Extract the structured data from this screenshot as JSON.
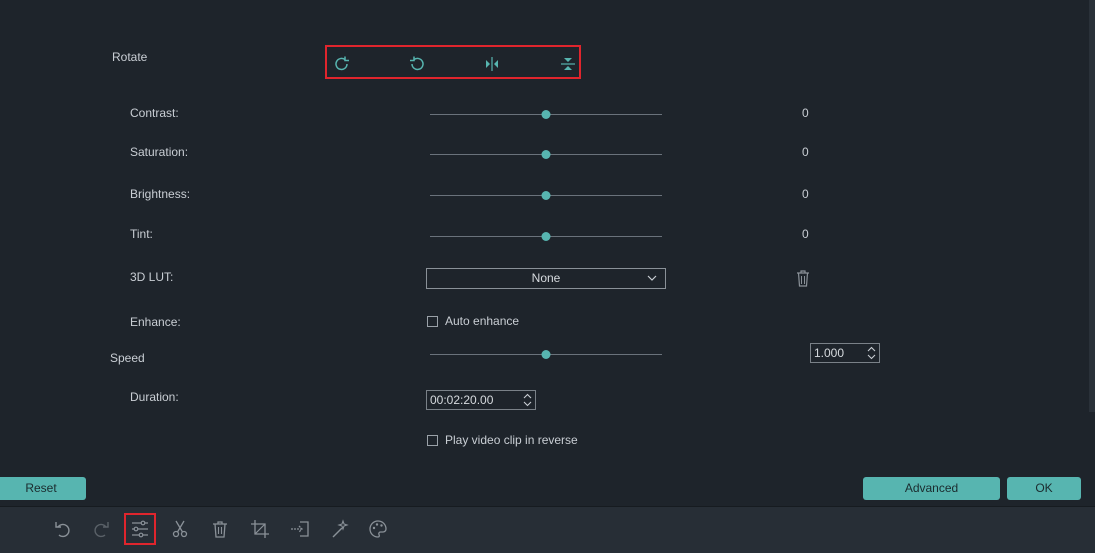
{
  "rotate": {
    "label": "Rotate",
    "icons": [
      "rotate-clockwise-icon",
      "rotate-counterclockwise-icon",
      "flip-horizontal-icon",
      "flip-vertical-icon"
    ]
  },
  "adjust": {
    "contrast": {
      "label": "Contrast:",
      "value": "0",
      "level": 0.5
    },
    "saturation": {
      "label": "Saturation:",
      "value": "0",
      "level": 0.5
    },
    "brightness": {
      "label": "Brightness:",
      "value": "0",
      "level": 0.5
    },
    "tint": {
      "label": "Tint:",
      "value": "0",
      "level": 0.5
    }
  },
  "lut": {
    "label": "3D LUT:",
    "selected": "None"
  },
  "enhance": {
    "label": "Enhance:",
    "checkbox_label": "Auto enhance",
    "checked": false
  },
  "speed": {
    "label": "Speed",
    "value": "1.000",
    "level": 0.5
  },
  "duration": {
    "label": "Duration:",
    "value": "00:02:20.00"
  },
  "reverse": {
    "checkbox_label": "Play video clip in reverse",
    "checked": false
  },
  "buttons": {
    "reset": "Reset",
    "advanced": "Advanced",
    "ok": "OK"
  },
  "toolbar": {
    "icons": [
      "undo-icon",
      "redo-icon",
      "adjust-icon",
      "cut-icon",
      "delete-icon",
      "crop-icon",
      "split-icon",
      "effect-icon",
      "color-palette-icon"
    ]
  },
  "colors": {
    "accent": "#57b5b0",
    "highlight": "#e0252d",
    "background": "#1e242b"
  }
}
